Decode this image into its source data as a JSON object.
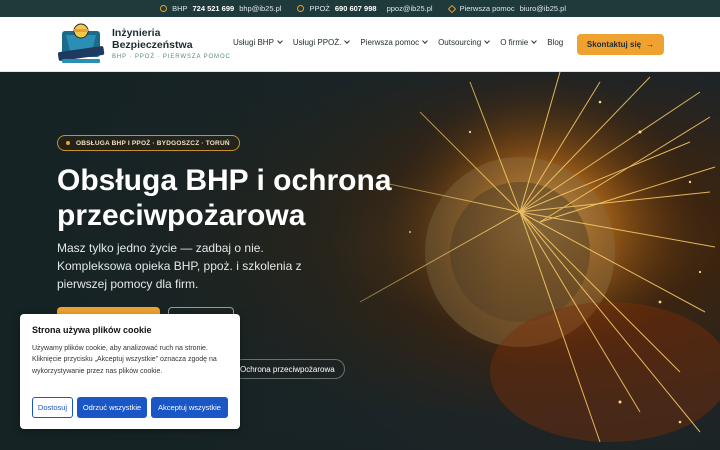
{
  "topbar": {
    "bhp_label": "BHP",
    "bhp_phone": "724 521 699",
    "bhp_email": "bhp@ib25.pl",
    "ppoz_label": "PPOŻ",
    "ppoz_phone": "690 607 998",
    "ppoz_email": "ppoz@ib25.pl",
    "fa_label": "Pierwsza pomoc",
    "fa_email": "biuro@ib25.pl"
  },
  "brand": {
    "name": "Inżynieria Bezpieczeństwa",
    "tagline": "BHP · PPOŻ · PIERWSZA POMOC"
  },
  "nav": {
    "items": [
      {
        "label": "Usługi BHP"
      },
      {
        "label": "Usługi PPOŻ."
      },
      {
        "label": "Pierwsza pomoc"
      },
      {
        "label": "Outsourcing"
      },
      {
        "label": "O firmie"
      },
      {
        "label": "Blog"
      }
    ],
    "cta_label": "Skontaktuj się"
  },
  "hero": {
    "badge": "OBSŁUGA BHP I PPOŻ · BYDGOSZCZ · TORUŃ",
    "title": "Obsługa BHP i ochrona przeciwpożarowa",
    "lead": "Masz tylko jedno życie — zadbaj o nie. Kompleksowa opieka BHP, ppoż. i szkolenia z pierwszej pomocy dla firm.",
    "chip_label": "Ochrona przeciwpożarowa"
  },
  "cookie": {
    "title": "Strona używa plików cookie",
    "text": "Używamy plików cookie, aby analizować ruch na stronie. Kliknięcie przycisku „Akceptuj wszystkie” oznacza zgodę na wykorzystywanie przez nas plików cookie.",
    "customize_label": "Dostosuj",
    "reject_label": "Odrzuć wszystkie",
    "accept_label": "Akceptuj wszystkie"
  },
  "colors": {
    "accent": "#efa22f",
    "topbar_bg": "#1f3a3a",
    "cookie_button": "#1a56c6"
  }
}
